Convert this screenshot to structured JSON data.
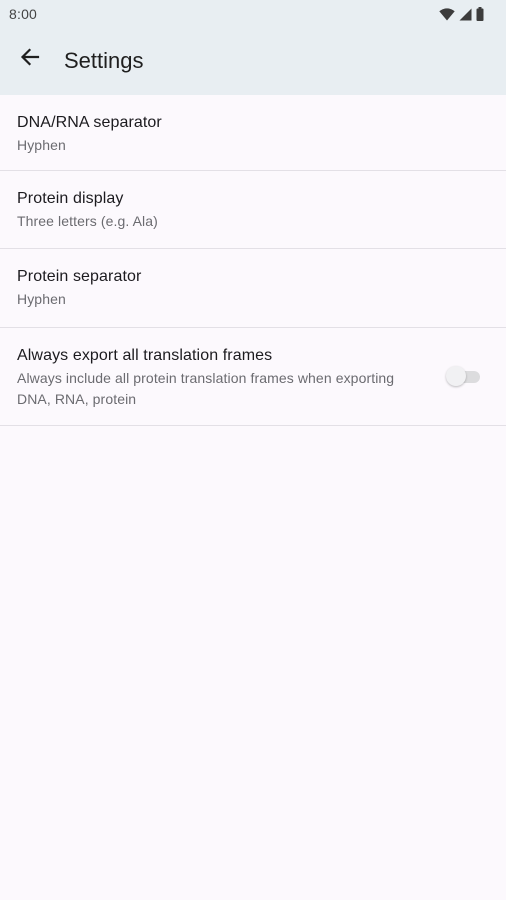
{
  "status_bar": {
    "time": "8:00",
    "icons": [
      "wifi-icon",
      "cellular-signal-icon",
      "battery-icon"
    ]
  },
  "app_bar": {
    "back_icon": "arrow-back-icon",
    "title": "Settings"
  },
  "settings": [
    {
      "title": "DNA/RNA separator",
      "summary": "Hyphen"
    },
    {
      "title": "Protein display",
      "summary": "Three letters (e.g. Ala)"
    },
    {
      "title": "Protein separator",
      "summary": "Hyphen"
    },
    {
      "title": "Always export all translation frames",
      "summary": "Always include all protein translation frames when exporting DNA, RNA, protein",
      "switch_on": false
    }
  ],
  "colors": {
    "app_bar_bg": "#e8eef2",
    "page_bg": "#fcf9fd",
    "divider": "#e3e0e6"
  }
}
